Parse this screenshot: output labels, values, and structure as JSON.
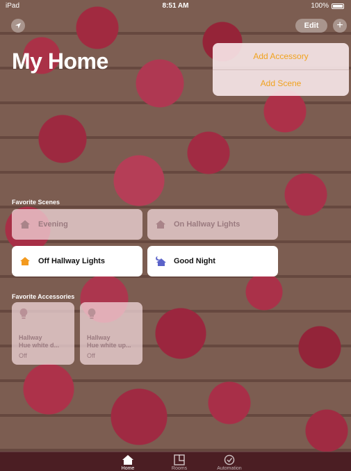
{
  "status_bar": {
    "carrier": "iPad",
    "time": "8:51 AM",
    "battery": "100%"
  },
  "header": {
    "title": "My Home",
    "edit_label": "Edit",
    "add_label": "+"
  },
  "add_menu": {
    "items": [
      "Add Accessory",
      "Add Scene"
    ],
    "color": "#f0a21e"
  },
  "favorite_scenes": {
    "title": "Favorite Scenes",
    "items": [
      {
        "label": "Evening",
        "active": false,
        "icon": "house-icon"
      },
      {
        "label": "On Hallway Lights",
        "active": false,
        "icon": "house-icon"
      },
      {
        "label": "Off Hallway Lights",
        "active": true,
        "icon": "house-orange-icon"
      },
      {
        "label": "Good Night",
        "active": true,
        "icon": "house-moon-icon"
      }
    ]
  },
  "favorite_accessories": {
    "title": "Favorite Accessories",
    "items": [
      {
        "room": "Hallway",
        "name": "Hue white d...",
        "state": "Off",
        "icon": "bulb-icon"
      },
      {
        "room": "Hallway",
        "name": "Hue white up...",
        "state": "Off",
        "icon": "bulb-icon"
      }
    ]
  },
  "tabbar": {
    "items": [
      {
        "label": "Home",
        "icon": "house-tab-icon",
        "active": true
      },
      {
        "label": "Rooms",
        "icon": "rooms-tab-icon",
        "active": false
      },
      {
        "label": "Automation",
        "icon": "automation-tab-icon",
        "active": false
      }
    ]
  }
}
